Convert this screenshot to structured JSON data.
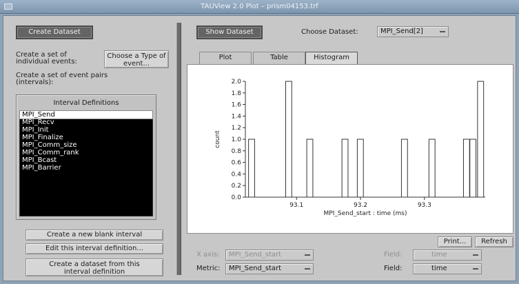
{
  "window": {
    "title": "TAUView 2.0 Plot – prism04153.trf"
  },
  "left": {
    "create_dataset_label": "Create Dataset",
    "individual_events_label": "Create a set of individual events:",
    "choose_type_button": "Choose a Type of event...",
    "event_pairs_label": "Create a set of event pairs (intervals):",
    "interval_definitions_title": "Interval Definitions",
    "interval_items": [
      "MPI_Send",
      "MPI_Recv",
      "MPI_Init",
      "MPI_Finalize",
      "MPI_Comm_size",
      "MPI_Comm_rank",
      "MPI_Bcast",
      "MPI_Barrier"
    ],
    "selected_index": 0,
    "new_interval_button": "Create a new blank interval",
    "edit_interval_button": "Edit this interval definition...",
    "create_from_definition_button": "Create a dataset from this interval definition"
  },
  "right": {
    "show_dataset_label": "Show Dataset",
    "choose_dataset_label": "Choose Dataset:",
    "choose_dataset_value": "MPI_Send[2]",
    "tabs": [
      "Plot",
      "Table",
      "Histogram"
    ],
    "active_tab": 2,
    "print_button": "Print...",
    "refresh_button": "Refresh",
    "x_axis_row": {
      "label": "X axis:",
      "value": "MPI_Send_start",
      "field_label": "Field:",
      "field_value": "time"
    },
    "metric_row": {
      "label": "Metric:",
      "value": "MPI_Send_start",
      "field_label": "Field:",
      "field_value": "time"
    }
  },
  "chart_data": {
    "type": "bar",
    "xlabel": "MPI_Send_start : time (ms)",
    "ylabel": "count",
    "ylim": [
      0,
      2.0
    ],
    "yticks": [
      "0.0",
      "0.2",
      "0.4",
      "0.6",
      "0.8",
      "1.0",
      "1.2",
      "1.4",
      "1.6",
      "1.8",
      "2.0"
    ],
    "xlim": [
      93.02,
      93.395
    ],
    "xticks": [
      93.1,
      93.2,
      93.3
    ],
    "xtick_labels": [
      "93.1",
      "93.2",
      "93.3"
    ],
    "bin_width": 0.0095,
    "bins": [
      {
        "x": 93.025,
        "count": 1
      },
      {
        "x": 93.083,
        "count": 2
      },
      {
        "x": 93.116,
        "count": 1
      },
      {
        "x": 93.171,
        "count": 1
      },
      {
        "x": 93.195,
        "count": 1
      },
      {
        "x": 93.264,
        "count": 1
      },
      {
        "x": 93.307,
        "count": 1
      },
      {
        "x": 93.361,
        "count": 1
      },
      {
        "x": 93.371,
        "count": 1
      },
      {
        "x": 93.383,
        "count": 2
      }
    ],
    "grid": false
  }
}
